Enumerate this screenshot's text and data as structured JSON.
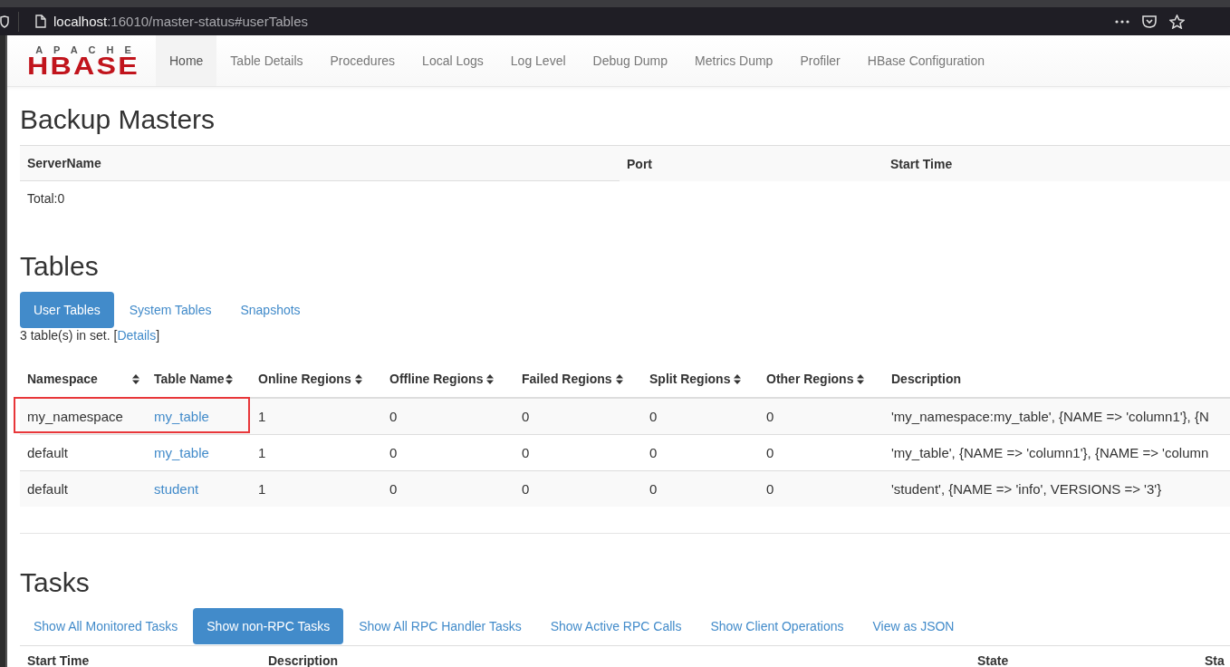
{
  "browser": {
    "url_host": "localhost",
    "url_rest": ":16010/master-status#userTables"
  },
  "navbar": {
    "logo_top": "APACHE",
    "logo_main": "HBASE",
    "items": [
      {
        "label": "Home",
        "selected": true
      },
      {
        "label": "Table Details",
        "selected": false
      },
      {
        "label": "Procedures",
        "selected": false
      },
      {
        "label": "Local Logs",
        "selected": false
      },
      {
        "label": "Log Level",
        "selected": false
      },
      {
        "label": "Debug Dump",
        "selected": false
      },
      {
        "label": "Metrics Dump",
        "selected": false
      },
      {
        "label": "Profiler",
        "selected": false
      },
      {
        "label": "HBase Configuration",
        "selected": false
      }
    ]
  },
  "backup_masters": {
    "title": "Backup Masters",
    "columns": [
      "ServerName",
      "Port",
      "Start Time"
    ],
    "total": "Total:0"
  },
  "tables": {
    "title": "Tables",
    "tabs": [
      {
        "label": "User Tables",
        "selected": true
      },
      {
        "label": "System Tables",
        "selected": false
      },
      {
        "label": "Snapshots",
        "selected": false
      }
    ],
    "count_before": "3 table(s) in set. [",
    "details_link": "Details",
    "count_after": "]",
    "columns": [
      "Namespace",
      "Table Name",
      "Online Regions",
      "Offline Regions",
      "Failed Regions",
      "Split Regions",
      "Other Regions",
      "Description"
    ],
    "rows": [
      {
        "highlighted": true,
        "cells": [
          "my_namespace",
          "my_table",
          "1",
          "0",
          "0",
          "0",
          "0",
          "'my_namespace:my_table', {NAME => 'column1'}, {N"
        ]
      },
      {
        "highlighted": false,
        "cells": [
          "default",
          "my_table",
          "1",
          "0",
          "0",
          "0",
          "0",
          "'my_table', {NAME => 'column1'}, {NAME => 'column"
        ]
      },
      {
        "highlighted": false,
        "cells": [
          "default",
          "student",
          "1",
          "0",
          "0",
          "0",
          "0",
          "'student', {NAME => 'info', VERSIONS => '3'}"
        ]
      }
    ]
  },
  "tasks": {
    "title": "Tasks",
    "tabs": [
      {
        "label": "Show All Monitored Tasks",
        "selected": false
      },
      {
        "label": "Show non-RPC Tasks",
        "selected": true
      },
      {
        "label": "Show All RPC Handler Tasks",
        "selected": false
      },
      {
        "label": "Show Active RPC Calls",
        "selected": false
      },
      {
        "label": "Show Client Operations",
        "selected": false
      },
      {
        "label": "View as JSON",
        "selected": false
      }
    ],
    "columns": [
      "Start Time",
      "Description",
      "State",
      "Sta"
    ]
  }
}
